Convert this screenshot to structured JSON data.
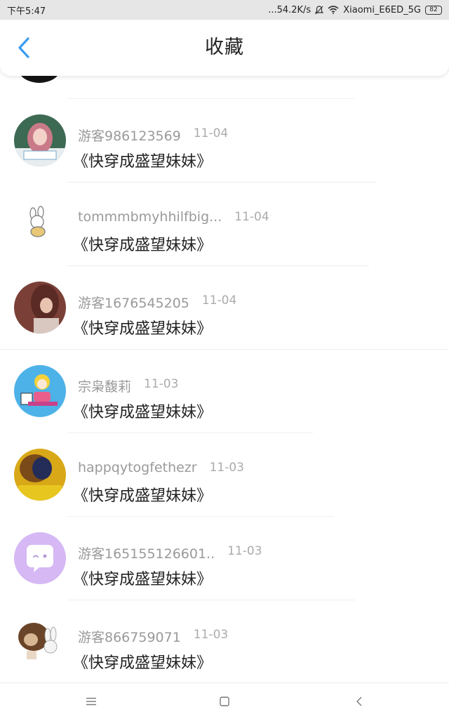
{
  "status_bar": {
    "time": "下午5:47",
    "network_speed": "...54.2K/s",
    "wifi_name": "Xiaomi_E6ED_5G",
    "battery": "82"
  },
  "header": {
    "title": "收藏",
    "back_icon": "chevron-left-icon",
    "accent_color": "#3b9cf0"
  },
  "favorites": [
    {
      "user": "游客986123569",
      "date": "11-04",
      "title": "《快穿成盛望妹妹》",
      "avatar": "girl-photo-avatar"
    },
    {
      "user": "tommmbmyhhilfbig...",
      "date": "11-04",
      "title": "《快穿成盛望妹妹》",
      "avatar": "bunny-sketch-avatar"
    },
    {
      "user": "游客1676545205",
      "date": "11-04",
      "title": "《快穿成盛望妹妹》",
      "avatar": "woman-photo-avatar"
    },
    {
      "user": "宗枭馥莉",
      "date": "11-03",
      "title": "《快穿成盛望妹妹》",
      "avatar": "cartoon-girl-avatar"
    },
    {
      "user": "happqytogfethezr",
      "date": "11-03",
      "title": "《快穿成盛望妹妹》",
      "avatar": "yellow-photo-avatar"
    },
    {
      "user": "游客165155126601..",
      "date": "11-03",
      "title": "《快穿成盛望妹妹》",
      "avatar": "chat-bubble-avatar"
    },
    {
      "user": "游客866759071",
      "date": "11-03",
      "title": "《快穿成盛望妹妹》",
      "avatar": "cartoon-pets-avatar"
    }
  ],
  "nav_bar": {
    "menu_icon": "menu-icon",
    "home_icon": "home-square-icon",
    "back_icon": "back-arrow-icon"
  }
}
